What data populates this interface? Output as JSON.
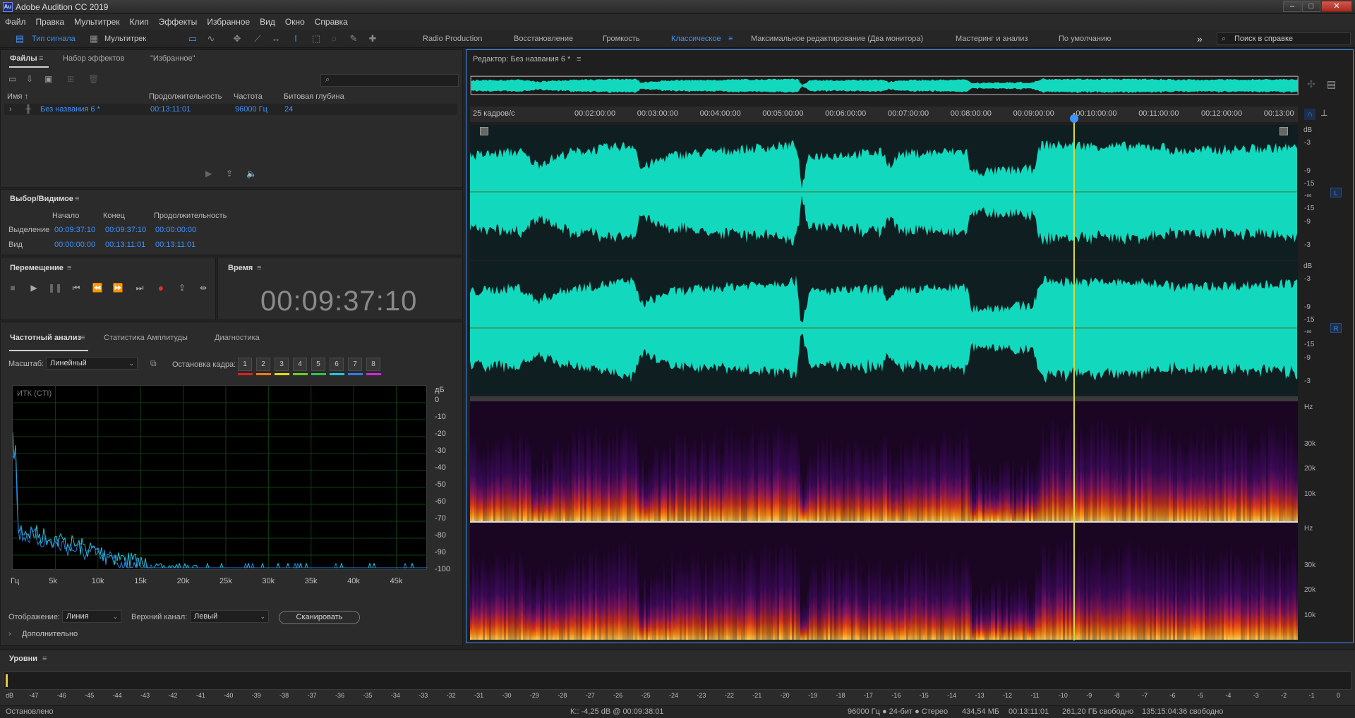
{
  "window": {
    "title": "Adobe Audition CC 2019",
    "icon_text": "Au",
    "minimize": "–",
    "maximize": "□",
    "close": "✕"
  },
  "menu": [
    "Файл",
    "Правка",
    "Мультитрек",
    "Клип",
    "Эффекты",
    "Избранное",
    "Вид",
    "Окно",
    "Справка"
  ],
  "toolbar": {
    "waveform_btn": "Тип сигнала",
    "multitrack_btn": "Мультитрек",
    "workspaces": [
      "Radio Production",
      "Восстановление",
      "Громкость",
      "Классическое",
      "Максимальное редактирование (Два монитора)",
      "Мастеринг и анализ",
      "По умолчанию"
    ],
    "active_workspace": "Классическое",
    "more": "»",
    "help_search_placeholder": "Поиск в справке"
  },
  "files_panel": {
    "tabs": [
      "Файлы",
      "Набор эффектов",
      "\"Избранное\""
    ],
    "columns": [
      "Имя ↑",
      "Продолжительность",
      "Частота",
      "Битовая глубина"
    ],
    "rows": [
      {
        "name": "Без названия 6 *",
        "duration": "00:13:11:01",
        "rate": "96000 Гц",
        "depth": "24"
      }
    ]
  },
  "selection_panel": {
    "title": "Выбор/Видимое",
    "headers": [
      "Начало",
      "Конец",
      "Продолжительность"
    ],
    "rows": [
      {
        "label": "Выделение",
        "start": "00:09:37:10",
        "end": "00:09:37:10",
        "duration": "00:00:00:00"
      },
      {
        "label": "Вид",
        "start": "00:00:00:00",
        "end": "00:13:11:01",
        "duration": "00:13:11:01"
      }
    ]
  },
  "transport_panel": {
    "title": "Перемещение"
  },
  "time_panel": {
    "title": "Время",
    "value": "00:09:37:10"
  },
  "freq_panel": {
    "tabs": [
      "Частотный анализ",
      "Статистика Амплитуды",
      "Диагностика"
    ],
    "scale_label": "Масштаб:",
    "scale_value": "Линейный",
    "hold_label": "Остановка кадра:",
    "frames": [
      "1",
      "2",
      "3",
      "4",
      "5",
      "6",
      "7",
      "8"
    ],
    "frame_colors": [
      "#e02020",
      "#f07a10",
      "#e8d800",
      "#6ccf1e",
      "#31c44c",
      "#1fc8e0",
      "#2f7de8",
      "#d02ad8"
    ],
    "graph_label": "ИТК (CTI)",
    "y_unit": "дБ",
    "y_ticks": [
      "0",
      "-10",
      "-20",
      "-30",
      "-40",
      "-50",
      "-60",
      "-70",
      "-80",
      "-90",
      "-100"
    ],
    "x_ticks": [
      "Гц",
      "5k",
      "10k",
      "15k",
      "20k",
      "25k",
      "30k",
      "35k",
      "40k",
      "45k"
    ],
    "display_label": "Отображение:",
    "display_value": "Линия",
    "channel_label": "Верхний канал:",
    "channel_value": "Левый",
    "scan_button": "Сканировать",
    "advanced": "Дополнительно"
  },
  "editor": {
    "title": "Редактор: Без названия 6 *",
    "ruler_label": "25 кадров/с",
    "ruler_ticks": [
      "00:02:00:00",
      "00:03:00:00",
      "00:04:00:00",
      "00:05:00:00",
      "00:06:00:00",
      "00:07:00:00",
      "00:08:00:00",
      "00:09:00:00",
      "00:10:00:00",
      "00:11:00:00",
      "00:12:00:00",
      "00:13:00"
    ],
    "playhead_fraction": 0.7295,
    "db_unit": "dB",
    "db_ticks": [
      "-3",
      "-9",
      "-15",
      "-∞",
      "-15",
      "-9",
      "-3"
    ],
    "hz_unit": "Hz",
    "hz_ticks": [
      "30k",
      "20k",
      "10k"
    ],
    "left_badge": "L",
    "right_badge": "R",
    "waveform_color": "#12d9bd",
    "accent_color": "#3d93ff"
  },
  "levels": {
    "title": "Уровни",
    "ticks": [
      "dB",
      "-47",
      "-46",
      "-45",
      "-44",
      "-43",
      "-42",
      "-41",
      "-40",
      "-39",
      "-38",
      "-37",
      "-36",
      "-35",
      "-34",
      "-33",
      "-32",
      "-31",
      "-30",
      "-29",
      "-28",
      "-27",
      "-26",
      "-25",
      "-24",
      "-23",
      "-22",
      "-21",
      "-20",
      "-19",
      "-18",
      "-17",
      "-16",
      "-15",
      "-14",
      "-13",
      "-12",
      "-11",
      "-10",
      "-9",
      "-8",
      "-7",
      "-6",
      "-5",
      "-4",
      "-3",
      "-2",
      "-1",
      "0"
    ]
  },
  "status": {
    "state": "Остановлено",
    "cursor": "К:: -4,25 dB @ 00:09:38:01",
    "format": "96000 Гц ● 24-бит ● Стерео",
    "size": "434,54 МБ",
    "duration": "00:13:11:01",
    "free": "261,20 ГБ свободно",
    "free_time": "135:15:04:36 свободно"
  }
}
